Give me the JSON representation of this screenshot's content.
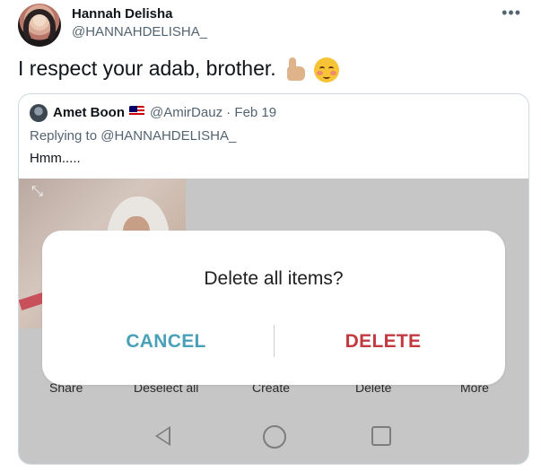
{
  "tweet": {
    "author_name": "Hannah Delisha",
    "author_handle": "@HANNAHDELISHA_",
    "more_icon": "•••",
    "text": "I respect your adab, brother.",
    "emojis": [
      "thumbs-up",
      "smiling-face-with-blush"
    ]
  },
  "quoted": {
    "author_name": "Amet Boon",
    "author_handle": "@AmirDauz",
    "date_sep": " · ",
    "date": "Feb 19",
    "replying_prefix": "Replying to ",
    "replying_to": "@HANNAHDELISHA_",
    "text": "Hmm.....",
    "flag": "malaysia-flag"
  },
  "media": {
    "expand_icon": "⤡",
    "dialog": {
      "title": "Delete all items?",
      "cancel_label": "CANCEL",
      "delete_label": "DELETE"
    },
    "bottom_actions": [
      "Share",
      "Deselect all",
      "Create",
      "Delete",
      "More"
    ],
    "colors": {
      "cancel": "#4aa0b8",
      "delete": "#c23a40",
      "backdrop": "#c6c6c6"
    }
  }
}
